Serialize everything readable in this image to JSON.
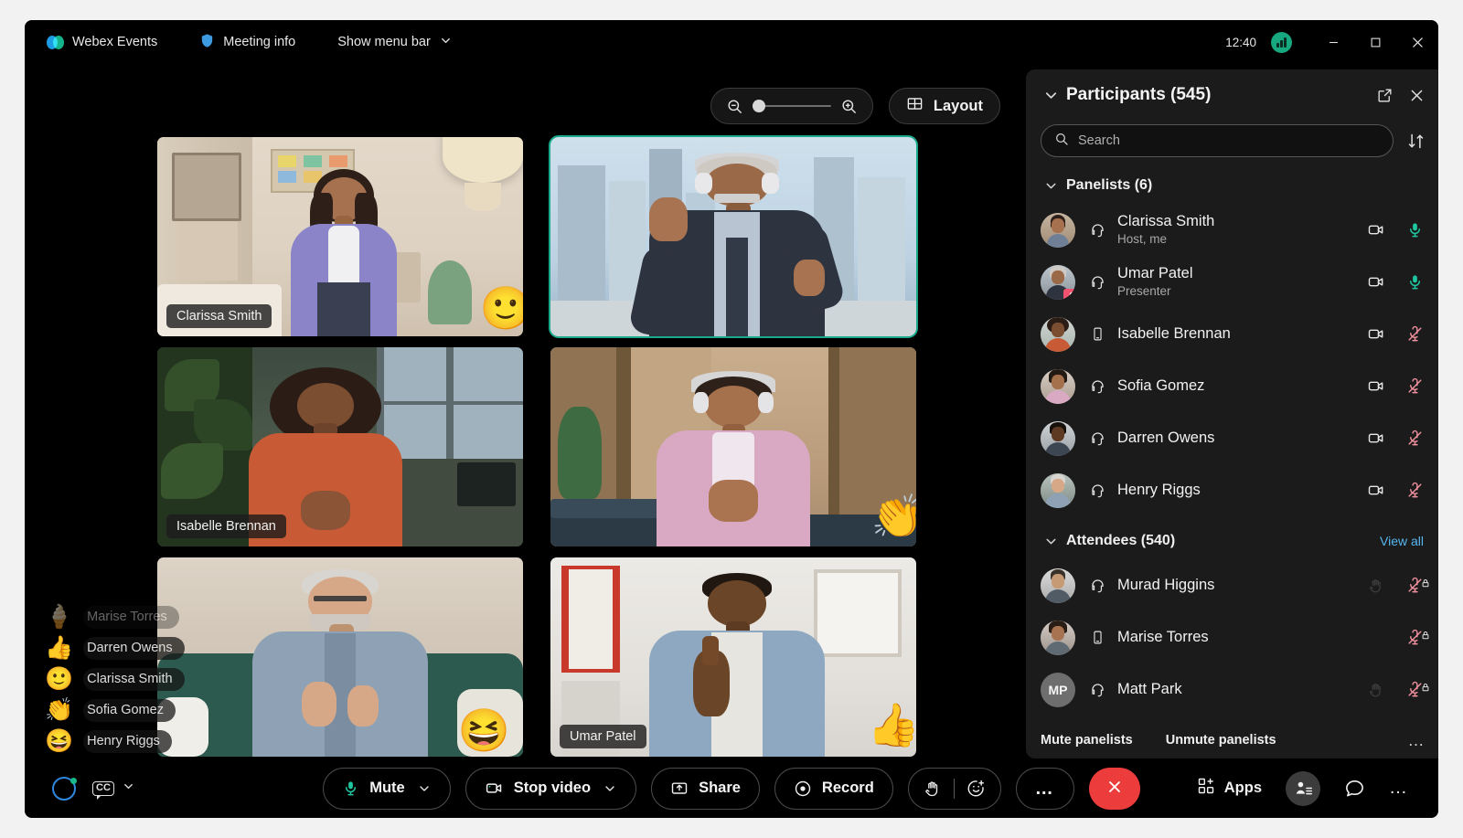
{
  "titlebar": {
    "app_name": "Webex Events",
    "meeting_info": "Meeting info",
    "show_menu_bar": "Show menu bar",
    "clock": "12:40",
    "icons": {
      "webex_logo": "webex-logo",
      "shield": "shield-icon",
      "chevron_down": "chevron-down-icon",
      "network": "network-quality-icon",
      "minimize": "minimize-icon",
      "maximize": "maximize-icon",
      "close": "close-icon"
    }
  },
  "stage": {
    "zoom_out_icon": "zoom-out-icon",
    "zoom_in_icon": "zoom-in-icon",
    "zoom_level": 0,
    "layout_label": "Layout",
    "layout_icon": "grid-layout-icon",
    "active_speaker_color": "#19a98a",
    "tiles": [
      {
        "name": "Clarissa Smith",
        "active": false,
        "emoji": "🙂",
        "emoji_name": "slightly-smiling-face"
      },
      {
        "name": "",
        "active": true,
        "emoji": "",
        "emoji_name": ""
      },
      {
        "name": "Isabelle Brennan",
        "active": false,
        "emoji": "",
        "emoji_name": ""
      },
      {
        "name": "",
        "active": false,
        "emoji": "👏",
        "emoji_name": "clapping-hands"
      },
      {
        "name": "",
        "active": false,
        "emoji": "😆",
        "emoji_name": "grinning-squinting-face"
      },
      {
        "name": "Umar Patel",
        "active": false,
        "emoji": "👍",
        "emoji_name": "thumbs-up"
      }
    ]
  },
  "reactions": [
    {
      "emoji": "🍦",
      "emoji_name": "ice-cream",
      "name": "Marise Torres",
      "fading": true
    },
    {
      "emoji": "👍",
      "emoji_name": "thumbs-up",
      "name": "Darren Owens",
      "fading": false
    },
    {
      "emoji": "🙂",
      "emoji_name": "slightly-smiling-face",
      "name": "Clarissa Smith",
      "fading": false
    },
    {
      "emoji": "👏",
      "emoji_name": "clapping-hands",
      "name": "Sofia Gomez",
      "fading": false
    },
    {
      "emoji": "😆",
      "emoji_name": "grinning-squinting-face",
      "name": "Henry Riggs",
      "fading": false
    }
  ],
  "panel": {
    "title": "Participants (545)",
    "collapse_icon": "chevron-down-icon",
    "popout_icon": "open-in-new-window-icon",
    "close_icon": "close-icon",
    "search_placeholder": "Search",
    "search_value": "",
    "search_icon": "search-icon",
    "sort_icon": "sort-arrows-icon",
    "panelists_group": "Panelists (6)",
    "attendees_group": "Attendees (540)",
    "view_all": "View all",
    "panelists": [
      {
        "name": "Clarissa Smith",
        "role": "Host, me",
        "device": "headset",
        "camera": "camera-on",
        "mic": "mic-live",
        "avatar_color": "#9e7e68"
      },
      {
        "name": "Umar Patel",
        "role": "Presenter",
        "device": "headset",
        "camera": "camera-on",
        "mic": "mic-live",
        "avatar_color": "#8a8a90",
        "badge": "sharing"
      },
      {
        "name": "Isabelle Brennan",
        "role": "",
        "device": "mobile",
        "camera": "camera-on",
        "mic": "mic-muted",
        "avatar_color": "#b8643c"
      },
      {
        "name": "Sofia Gomez",
        "role": "",
        "device": "headset",
        "camera": "camera-on",
        "mic": "mic-muted",
        "avatar_color": "#c09080"
      },
      {
        "name": "Darren Owens",
        "role": "",
        "device": "headset",
        "camera": "camera-on",
        "mic": "mic-muted",
        "avatar_color": "#7a7a80"
      },
      {
        "name": "Henry Riggs",
        "role": "",
        "device": "headset",
        "camera": "camera-on",
        "mic": "mic-muted",
        "avatar_color": "#6b7a70"
      }
    ],
    "attendees": [
      {
        "name": "Murad Higgins",
        "role": "",
        "device": "headset",
        "hand": true,
        "mic": "mic-muted-locked",
        "avatar_color": "#9a9a9a",
        "initials": ""
      },
      {
        "name": "Marise Torres",
        "role": "",
        "device": "mobile",
        "hand": false,
        "mic": "mic-muted-locked",
        "avatar_color": "#8e7f74",
        "initials": ""
      },
      {
        "name": "Matt Park",
        "role": "",
        "device": "headset",
        "hand": true,
        "mic": "mic-muted-locked",
        "avatar_color": "#6e6e6e",
        "initials": "MP"
      }
    ],
    "footer": {
      "mute_panelists": "Mute panelists",
      "unmute_panelists": "Unmute panelists",
      "more": "…"
    }
  },
  "controls": {
    "assistant_icon": "webex-assistant-icon",
    "captions_label": "CC",
    "captions_caret": "chevron-down-icon",
    "mute_label": "Mute",
    "mute_icon": "microphone-icon",
    "stop_video_label": "Stop video",
    "stop_video_icon": "camera-icon",
    "share_label": "Share",
    "share_icon": "share-screen-icon",
    "record_label": "Record",
    "record_icon": "record-icon",
    "raise_hand_icon": "raise-hand-icon",
    "reactions_icon": "add-reaction-icon",
    "more_options": "…",
    "end_meeting_icon": "end-meeting-icon",
    "end_meeting_color": "#ed3c3c",
    "apps_label": "Apps",
    "apps_icon": "apps-icon",
    "participants_icon": "participants-icon",
    "chat_icon": "chat-bubble-icon",
    "more_icon": "more-horizontal-icon"
  }
}
